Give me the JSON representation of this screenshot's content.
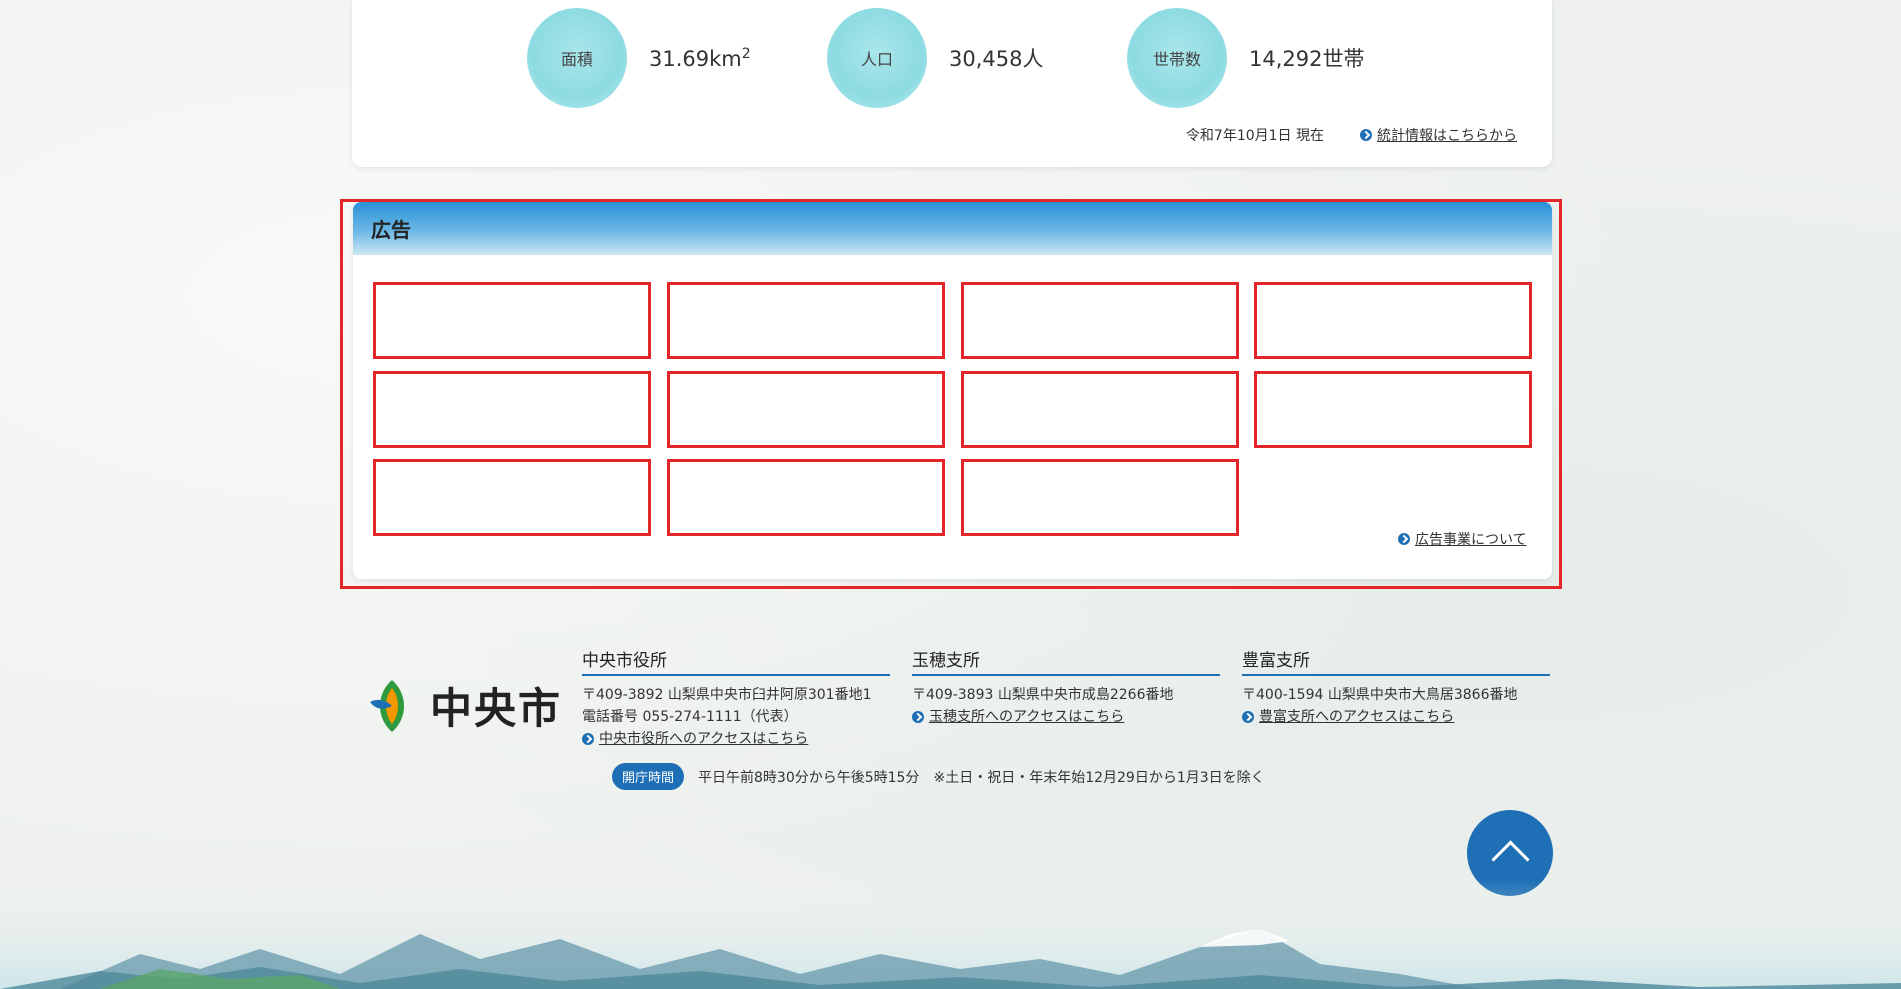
{
  "stats": {
    "area": {
      "label": "面積",
      "value": "31.69km",
      "sup": "2"
    },
    "population": {
      "label": "人口",
      "value": "30,458人"
    },
    "households": {
      "label": "世帯数",
      "value": "14,292世帯"
    },
    "as_of": "令和7年10月1日 現在",
    "stats_link": "統計情報はこちらから"
  },
  "ads": {
    "heading": "広告",
    "slot_count": 11,
    "about_link": "広告事業について"
  },
  "footer": {
    "logo_text": "中央市",
    "offices": [
      {
        "name": "中央市役所",
        "address": "〒409-3892 山梨県中央市臼井阿原301番地1",
        "phone": "電話番号 055-274-1111（代表）",
        "access_link": "中央市役所へのアクセスはこちら"
      },
      {
        "name": "玉穂支所",
        "address": "〒409-3893 山梨県中央市成島2266番地",
        "access_link": "玉穂支所へのアクセスはこちら"
      },
      {
        "name": "豊富支所",
        "address": "〒400-1594 山梨県中央市大鳥居3866番地",
        "access_link": "豊富支所へのアクセスはこちら"
      }
    ],
    "hours_badge": "開庁時間",
    "hours_text": "平日午前8時30分から午後5時15分　※土日・祝日・年末年始12月29日から1月3日を除く"
  },
  "colors": {
    "accent": "#1e6fb5",
    "highlight": "#e4262b",
    "stat_blob": "#8ddbe2"
  },
  "icons": {
    "link": "arrow-circle-icon",
    "back_to_top": "chevron-up-icon"
  }
}
